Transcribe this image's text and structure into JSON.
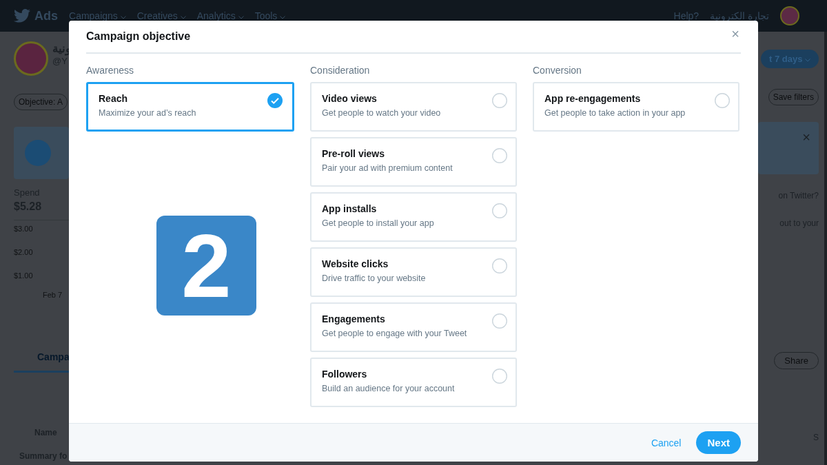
{
  "nav": {
    "brand": "Ads",
    "menus": [
      "Campaigns",
      "Creatives",
      "Analytics",
      "Tools"
    ],
    "help": "Help?",
    "account": "تجارة الكترونية"
  },
  "background": {
    "left": {
      "name": "ونية",
      "handle": "@Y",
      "filter": "Objective: A",
      "spend_label": "Spend",
      "spend_value": "$5.28",
      "ticks": [
        "$3.00",
        "$2.00",
        "$1.00"
      ],
      "date": "Feb 7",
      "tab": "Campa",
      "column": "Name",
      "summary": "Summary fo"
    },
    "right": {
      "range": "t 7 days",
      "save": "Save filters",
      "line1": "on Twitter?",
      "line2": "out to your",
      "share": "Share",
      "column": "S",
      "dismiss": "×"
    }
  },
  "modal": {
    "title": "Campaign objective",
    "columns": [
      {
        "heading": "Awareness",
        "options": [
          {
            "title": "Reach",
            "description": "Maximize your ad’s reach",
            "selected": true
          }
        ]
      },
      {
        "heading": "Consideration",
        "options": [
          {
            "title": "Video views",
            "description": "Get people to watch your video",
            "selected": false
          },
          {
            "title": "Pre-roll views",
            "description": "Pair your ad with premium content",
            "selected": false
          },
          {
            "title": "App installs",
            "description": "Get people to install your app",
            "selected": false
          },
          {
            "title": "Website clicks",
            "description": "Drive traffic to your website",
            "selected": false
          },
          {
            "title": "Engagements",
            "description": "Get people to engage with your Tweet",
            "selected": false
          },
          {
            "title": "Followers",
            "description": "Build an audience for your account",
            "selected": false
          }
        ]
      },
      {
        "heading": "Conversion",
        "options": [
          {
            "title": "App re-engagements",
            "description": "Get people to take action in your app",
            "selected": false
          }
        ]
      }
    ],
    "step_badge": "2",
    "close": "×",
    "cancel": "Cancel",
    "next": "Next"
  }
}
